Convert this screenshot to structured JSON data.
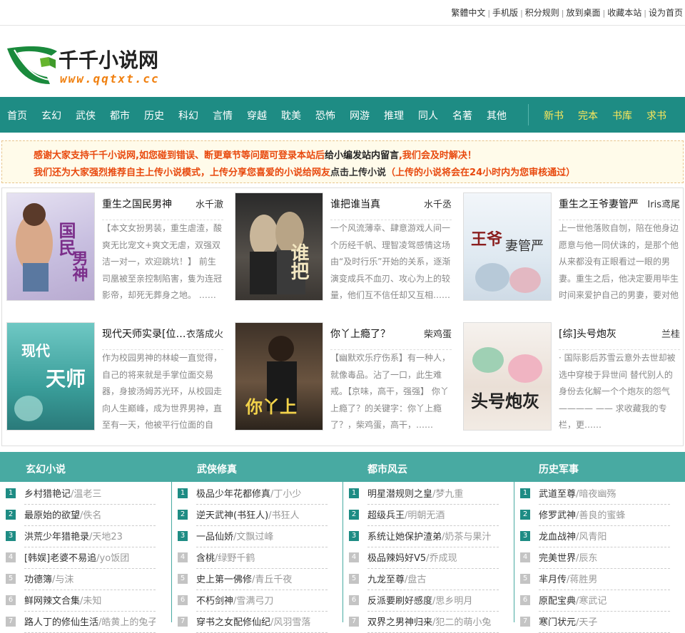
{
  "topbar": {
    "links": [
      "繁體中文",
      "手机版",
      "积分规则",
      "放到桌面",
      "收藏本站",
      "设为首页"
    ]
  },
  "logo": {
    "name": "千千小说网",
    "url_text": "www.qqtxt.cc"
  },
  "nav": {
    "items": [
      "首页",
      "玄幻",
      "武侠",
      "都市",
      "历史",
      "科幻",
      "言情",
      "穿越",
      "耽美",
      "恐怖",
      "网游",
      "推理",
      "同人",
      "名著",
      "其他"
    ],
    "hot_items": [
      "新书",
      "完本",
      "书库",
      "求书"
    ]
  },
  "notice": {
    "line1_a": "感谢大家支持千千小说网,如您碰到错误、断更章节等问题可登录本站后",
    "line1_b": "给小编发站内留言",
    "line1_c": ",我们会及时解决！",
    "line2_a": "我们还为大家强烈推荐自主上传小说模式，上传分享您喜爱的小说给网友",
    "line2_b": "点击上传小说",
    "line2_c": "（上传的小说将会在24小时内为您审核通过）"
  },
  "recommend": [
    {
      "title": "重生之国民男神",
      "author": "水千澈",
      "desc": "【本文女扮男装，重生虐渣，酸爽无比宠文+爽文无虐，双强双洁一对一，欢迎跳坑！】 前生司凰被至亲控制陷害，隻为连冠影帝，却死无葬身之地。 ……",
      "cover_text": "国民男神"
    },
    {
      "title": "谁把谁当真",
      "author": "水千丞",
      "desc": "一个风流薄幸、肆意游戏人间一个历经千帆、理智凌驾感情这场由“及时行乐”开始的关系，逐渐演变成兵不血刃、攻心为上的较量，他们互不信任却又互相……",
      "cover_text": "谁把谁当真"
    },
    {
      "title": "重生之王爷妻管严",
      "author": "Iris鸢尾",
      "desc": "上一世他落败自刎，陪在他身边愿意与他一同伏诛的，是那个他从来都没有正眼看过一眼的男妻。重生之后，他决定要用毕生时间来爱护自己的男妻，要对他不……",
      "cover_text": "王爷妻管严"
    },
    {
      "title": "现代天师实录[位面]",
      "author": "衣落成火",
      "desc": "作为校园男神的林峻一直觉得，自己的将来就是手掌位面交易器，身披汤姆苏光环，从校园走向人生巅峰，成为世界男神，直至有一天，他被平行位面的自己……",
      "cover_text": "现代天师"
    },
    {
      "title": "你丫上瘾了？",
      "author": "柴鸡蛋",
      "desc": "【幽默欢乐疗伤系】有一种人，就像毒品。沾了一口，此生难戒。【京味，高干，强强】 你丫上瘾了？的关键字：你丫上瘾了？，柴鸡蛋，高干，……",
      "cover_text": "你丫上瘾了"
    },
    {
      "title": "[综]头号炮灰",
      "author": "兰桂",
      "desc": "· 国际影后苏雪云意外去世却被选中穿梭于异世间 替代别人的身份去化解一个个炮灰的怨气 ———— —— 求收藏我的专栏，更……",
      "cover_text": "头号炮灰"
    }
  ],
  "categories": [
    {
      "name": "玄幻小说",
      "rows": [
        {
          "title": "乡村猎艳记",
          "author": "温老三"
        },
        {
          "title": "最原始的欲望",
          "author": "佚名"
        },
        {
          "title": "洪荒少年猎艳录",
          "author": "天地23"
        },
        {
          "title": "[韩娱]老婆不易追",
          "author": "yo饭团"
        },
        {
          "title": "功德簿",
          "author": "与沫"
        },
        {
          "title": "鲜网辣文合集",
          "author": "未知"
        },
        {
          "title": "路人丁的修仙生活",
          "author": "皓黄上的兔子"
        }
      ]
    },
    {
      "name": "武侠修真",
      "rows": [
        {
          "title": "极品少年花都修真",
          "author": "丁小少"
        },
        {
          "title": "逆天武神(书狂人)",
          "author": "书狂人"
        },
        {
          "title": "一品仙娇",
          "author": "文飘过峰"
        },
        {
          "title": "含桃",
          "author": "绿野千鹤"
        },
        {
          "title": "史上第一佛修",
          "author": "青丘千夜"
        },
        {
          "title": "不朽剑神",
          "author": "雪满弓刀"
        },
        {
          "title": "穿书之女配修仙纪",
          "author": "风羽雪落"
        }
      ]
    },
    {
      "name": "都市风云",
      "rows": [
        {
          "title": "明星潜规则之皇",
          "author": "梦九重"
        },
        {
          "title": "超级兵王",
          "author": "明朝无酒"
        },
        {
          "title": "系统让她保护渣弟",
          "author": "奶茶与果汁"
        },
        {
          "title": "极品辣妈好V5",
          "author": "乔成现"
        },
        {
          "title": "九龙至尊",
          "author": "盘古"
        },
        {
          "title": "反派要刷好感度",
          "author": "思乡明月"
        },
        {
          "title": "双界之男神归来",
          "author": "犯二的萌小兔"
        }
      ]
    },
    {
      "name": "历史军事",
      "rows": [
        {
          "title": "武道至尊",
          "author": "暗夜幽殇"
        },
        {
          "title": "修罗武神",
          "author": "善良的蜜蜂"
        },
        {
          "title": "龙血战神",
          "author": "风青阳"
        },
        {
          "title": "完美世界",
          "author": "辰东"
        },
        {
          "title": "芈月传",
          "author": "蒋胜男"
        },
        {
          "title": "原配宝典",
          "author": "寒武记"
        },
        {
          "title": "寒门状元",
          "author": "天子"
        }
      ]
    }
  ],
  "colors": {
    "nav": "#1e8c84",
    "catbar": "#48aaa2",
    "notice_red": "#e8490e",
    "hot": "#ffe95a"
  }
}
